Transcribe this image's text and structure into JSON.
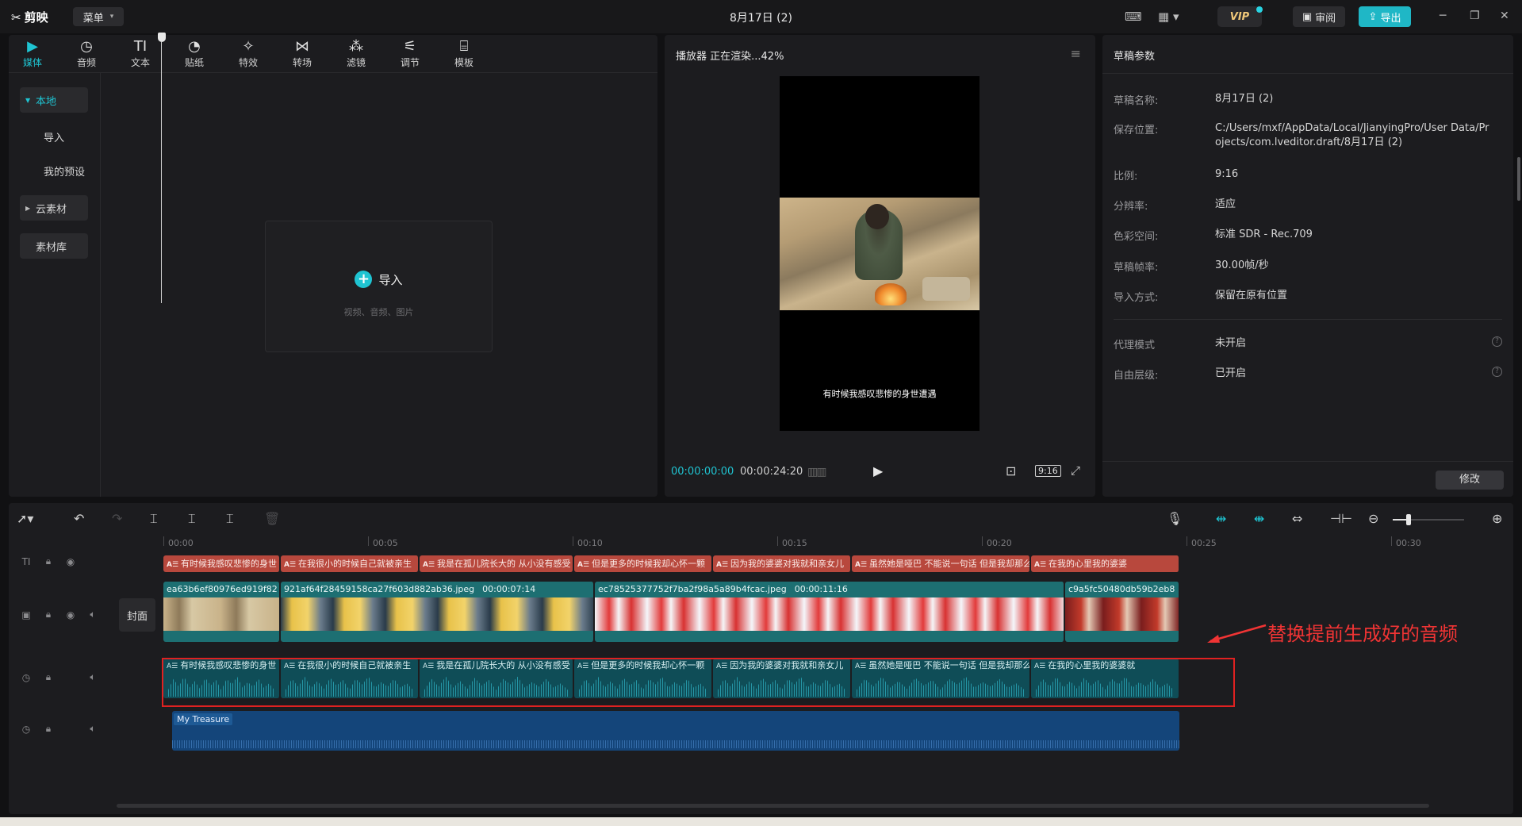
{
  "app": {
    "name": "剪映",
    "menu_label": "菜单",
    "title": "8月17日 (2)",
    "vip_label": "VIP",
    "review_label": "审阅",
    "export_label": "导出"
  },
  "media": {
    "tabs": [
      {
        "label": "媒体",
        "icon": "media-icon"
      },
      {
        "label": "音频",
        "icon": "audio-icon"
      },
      {
        "label": "文本",
        "icon": "text-icon"
      },
      {
        "label": "贴纸",
        "icon": "sticker-icon"
      },
      {
        "label": "特效",
        "icon": "effects-icon"
      },
      {
        "label": "转场",
        "icon": "transition-icon"
      },
      {
        "label": "滤镜",
        "icon": "filter-icon"
      },
      {
        "label": "调节",
        "icon": "adjust-icon"
      },
      {
        "label": "模板",
        "icon": "template-icon"
      }
    ],
    "active_tab": "媒体",
    "side_nav": {
      "local": "本地",
      "import": "导入",
      "presets": "我的预设",
      "cloud": "云素材",
      "library": "素材库"
    },
    "import_box": {
      "label": "导入",
      "hint": "视频、音频、图片"
    }
  },
  "player": {
    "header": "播放器  正在渲染...42%",
    "subtitle": "有时候我感叹悲惨的身世遭遇",
    "time_current": "00:00:00:00",
    "time_total": "00:00:24:20",
    "ratio": "9:16"
  },
  "draft": {
    "title": "草稿参数",
    "props": [
      {
        "key": "草稿名称:",
        "value": "8月17日 (2)"
      },
      {
        "key": "保存位置:",
        "value": "C:/Users/mxf/AppData/Local/JianyingPro/User Data/Projects/com.lveditor.draft/8月17日 (2)"
      },
      {
        "key": "比例:",
        "value": "9:16"
      },
      {
        "key": "分辨率:",
        "value": "适应"
      },
      {
        "key": "色彩空间:",
        "value": "标准 SDR - Rec.709"
      },
      {
        "key": "草稿帧率:",
        "value": "30.00帧/秒"
      },
      {
        "key": "导入方式:",
        "value": "保留在原有位置"
      },
      {
        "key": "代理模式",
        "value": "未开启"
      },
      {
        "key": "自由层级:",
        "value": "已开启"
      }
    ],
    "modify_label": "修改"
  },
  "timeline": {
    "ruler": [
      "00:00",
      "00:05",
      "00:10",
      "00:15",
      "00:20",
      "00:25",
      "00:30"
    ],
    "cover_label": "封面",
    "text_clips": [
      "有时候我感叹悲惨的身世",
      "在我很小的时候自己就被亲生",
      "我是在孤儿院长大的 从小没有感受",
      "但是更多的时候我却心怀一颗",
      "因为我的婆婆对我就和亲女儿",
      "虽然她是哑巴 不能说一句话 但是我却那么",
      "在我的心里我的婆婆"
    ],
    "video_clips": [
      {
        "name": "ea63b6ef80976ed919f82",
        "duration": ""
      },
      {
        "name": "921af64f28459158ca27f603d882ab36.jpeg",
        "duration": "00:00:07:14"
      },
      {
        "name": "ec78525377752f7ba2f98a5a89b4fcac.jpeg",
        "duration": "00:00:11:16"
      },
      {
        "name": "c9a5fc50480db59b2eb8",
        "duration": ""
      }
    ],
    "audio_clips": [
      "有时候我感叹悲惨的身世",
      "在我很小的时候自己就被亲生",
      "我是在孤儿院长大的 从小没有感受",
      "但是更多的时候我却心怀一颗",
      "因为我的婆婆对我就和亲女儿",
      "虽然她是哑巴 不能说一句话 但是我却那么",
      "在我的心里我的婆婆就"
    ],
    "music_label": "My Treasure"
  },
  "annotation": {
    "text": "替换提前生成好的音频",
    "color": "#e02121"
  },
  "colors": {
    "accent": "#1fc4d2",
    "text_track": "#b8483d",
    "video_track": "#1d6f72",
    "audio_track": "#0f4d57",
    "music_track": "#14457a"
  }
}
